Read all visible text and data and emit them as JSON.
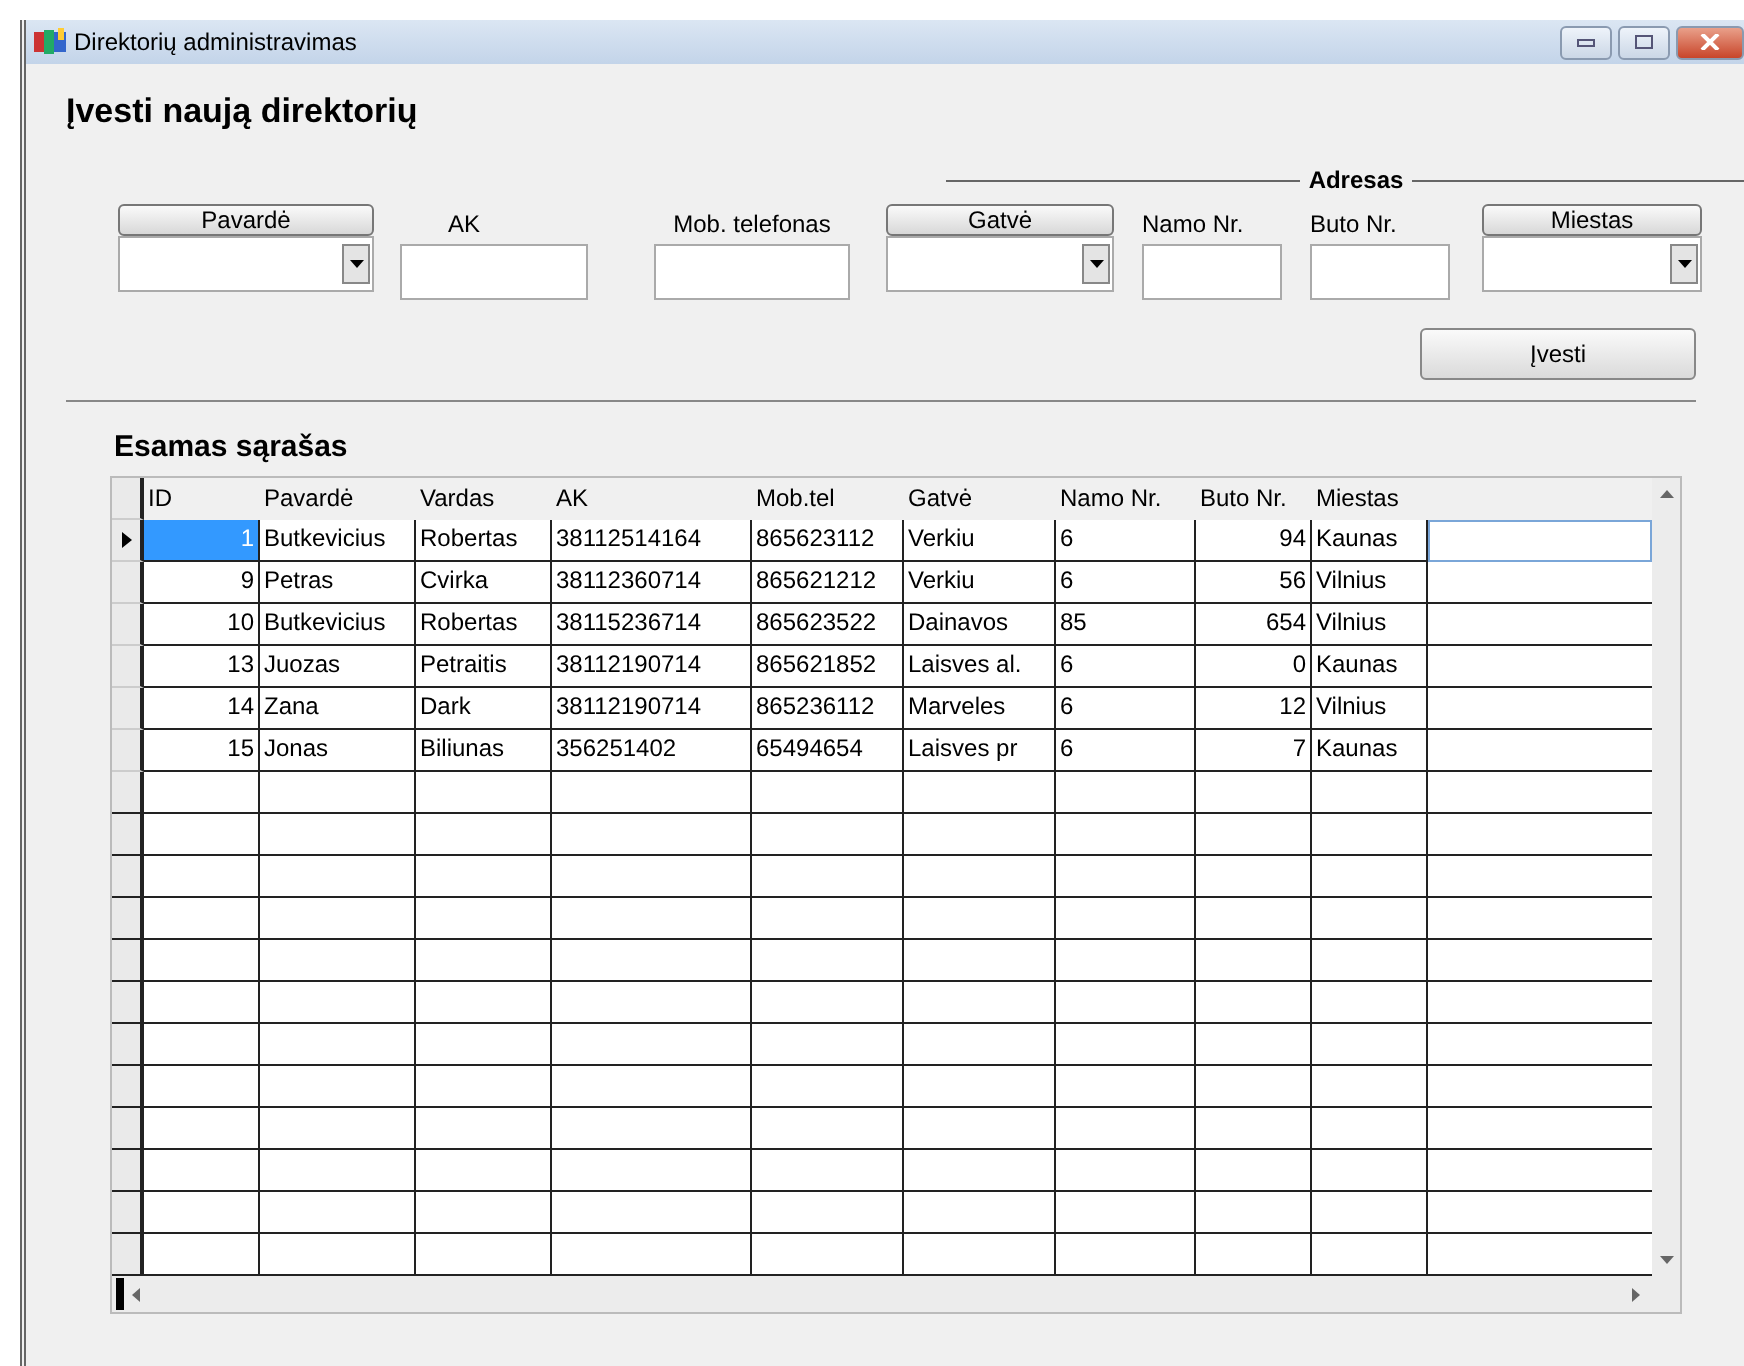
{
  "window": {
    "title": "Direktorių administravimas"
  },
  "form": {
    "title": "Įvesti naują direktorių",
    "address_title": "Adresas",
    "fields": [
      {
        "kind": "combo",
        "label": "Pavardė"
      },
      {
        "kind": "text",
        "label": "AK"
      },
      {
        "kind": "text",
        "label": "Mob. telefonas"
      },
      {
        "kind": "combo",
        "label": "Gatvė"
      },
      {
        "kind": "text",
        "label": "Namo Nr."
      },
      {
        "kind": "text",
        "label": "Buto Nr."
      },
      {
        "kind": "combo",
        "label": "Miestas"
      }
    ],
    "submit": "Įvesti"
  },
  "list": {
    "title": "Esamas sąrašas",
    "columns": [
      {
        "label": "ID"
      },
      {
        "label": "Pavardė"
      },
      {
        "label": "Vardas"
      },
      {
        "label": "AK"
      },
      {
        "label": "Mob.tel"
      },
      {
        "label": "Gatvė"
      },
      {
        "label": "Namo Nr."
      },
      {
        "label": "Buto Nr."
      },
      {
        "label": "Miestas"
      }
    ],
    "rows": [
      {
        "selected": true,
        "cells": [
          "1",
          "Butkevicius",
          "Robertas",
          "38112514164",
          "865623112",
          "Verkiu",
          "6",
          "94",
          "Kaunas"
        ]
      },
      {
        "selected": false,
        "cells": [
          "9",
          "Petras",
          "Cvirka",
          "38112360714",
          "865621212",
          "Verkiu",
          "6",
          "56",
          "Vilnius"
        ]
      },
      {
        "selected": false,
        "cells": [
          "10",
          "Butkevicius",
          "Robertas",
          "38115236714",
          "865623522",
          "Dainavos",
          "85",
          "654",
          "Vilnius"
        ]
      },
      {
        "selected": false,
        "cells": [
          "13",
          "Juozas",
          "Petraitis",
          "38112190714",
          "865621852",
          "Laisves al.",
          "6",
          "0",
          "Kaunas"
        ]
      },
      {
        "selected": false,
        "cells": [
          "14",
          "Zana",
          "Dark",
          "38112190714",
          "865236112",
          "Marveles",
          "6",
          "12",
          "Vilnius"
        ]
      },
      {
        "selected": false,
        "cells": [
          "15",
          "Jonas",
          "Biliunas",
          "356251402",
          "65494654",
          "Laisves pr",
          "6",
          "7",
          "Kaunas"
        ]
      }
    ]
  }
}
